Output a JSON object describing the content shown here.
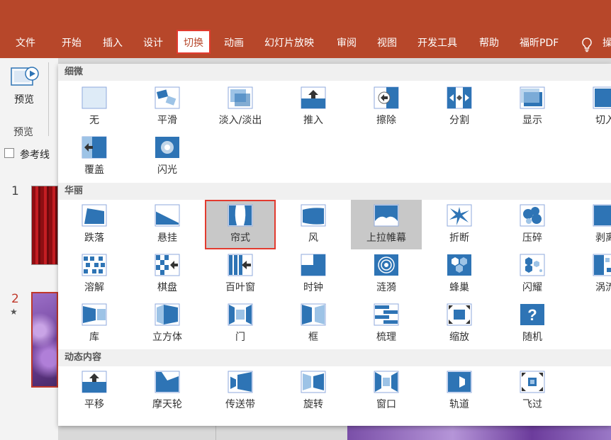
{
  "ribbon": {
    "tabs": [
      {
        "label": "文件"
      },
      {
        "label": "开始"
      },
      {
        "label": "插入"
      },
      {
        "label": "设计"
      },
      {
        "label": "切换"
      },
      {
        "label": "动画"
      },
      {
        "label": "幻灯片放映"
      },
      {
        "label": "审阅"
      },
      {
        "label": "视图"
      },
      {
        "label": "开发工具"
      },
      {
        "label": "帮助"
      },
      {
        "label": "福昕PDF"
      }
    ],
    "active_tab": "切换",
    "tell_me": "操"
  },
  "preview": {
    "button_label": "预览",
    "group_label": "预览"
  },
  "guides": {
    "label": "参考线",
    "checked": false
  },
  "slides": [
    {
      "number": "1",
      "selected": false
    },
    {
      "number": "2",
      "selected": true,
      "has_animation": "★"
    }
  ],
  "gallery": {
    "sections": [
      {
        "title": "细微",
        "items": [
          {
            "label": "无",
            "icon": "none-transition-icon"
          },
          {
            "label": "平滑",
            "icon": "morph-icon"
          },
          {
            "label": "淡入/淡出",
            "icon": "fade-icon"
          },
          {
            "label": "推入",
            "icon": "push-icon"
          },
          {
            "label": "擦除",
            "icon": "wipe-icon"
          },
          {
            "label": "分割",
            "icon": "split-icon"
          },
          {
            "label": "显示",
            "icon": "reveal-icon"
          },
          {
            "label": "切入",
            "icon": "cut-icon"
          },
          {
            "label": "覆盖",
            "icon": "cover-icon"
          },
          {
            "label": "闪光",
            "icon": "flash-icon"
          }
        ]
      },
      {
        "title": "华丽",
        "items": [
          {
            "label": "跌落",
            "icon": "fall-over-icon"
          },
          {
            "label": "悬挂",
            "icon": "drape-icon"
          },
          {
            "label": "帘式",
            "icon": "curtains-icon",
            "selected": true,
            "highlighted": true
          },
          {
            "label": "风",
            "icon": "wind-icon"
          },
          {
            "label": "上拉帷幕",
            "icon": "prestige-icon",
            "hover": true
          },
          {
            "label": "折断",
            "icon": "fracture-icon"
          },
          {
            "label": "压碎",
            "icon": "crush-icon"
          },
          {
            "label": "剥离",
            "icon": "peel-off-icon"
          },
          {
            "label": "溶解",
            "icon": "dissolve-icon"
          },
          {
            "label": "棋盘",
            "icon": "checkerboard-icon"
          },
          {
            "label": "百叶窗",
            "icon": "blinds-icon"
          },
          {
            "label": "时钟",
            "icon": "clock-icon"
          },
          {
            "label": "涟漪",
            "icon": "ripple-icon"
          },
          {
            "label": "蜂巢",
            "icon": "honeycomb-icon"
          },
          {
            "label": "闪耀",
            "icon": "glitter-icon"
          },
          {
            "label": "涡流",
            "icon": "vortex-icon"
          },
          {
            "label": "库",
            "icon": "gallery-icon"
          },
          {
            "label": "立方体",
            "icon": "cube-icon"
          },
          {
            "label": "门",
            "icon": "doors-icon"
          },
          {
            "label": "框",
            "icon": "box-icon"
          },
          {
            "label": "梳理",
            "icon": "comb-icon"
          },
          {
            "label": "缩放",
            "icon": "zoom-icon"
          },
          {
            "label": "随机",
            "icon": "random-icon"
          }
        ]
      },
      {
        "title": "动态内容",
        "items": [
          {
            "label": "平移",
            "icon": "pan-icon"
          },
          {
            "label": "摩天轮",
            "icon": "ferris-wheel-icon"
          },
          {
            "label": "传送带",
            "icon": "conveyor-icon"
          },
          {
            "label": "旋转",
            "icon": "rotate-icon"
          },
          {
            "label": "窗口",
            "icon": "window-icon"
          },
          {
            "label": "轨道",
            "icon": "orbit-icon"
          },
          {
            "label": "飞过",
            "icon": "fly-through-icon"
          }
        ]
      }
    ]
  },
  "colors": {
    "accent": "#b7472a",
    "highlight_border": "#e23b2f",
    "icon_blue": "#2e74b5"
  }
}
